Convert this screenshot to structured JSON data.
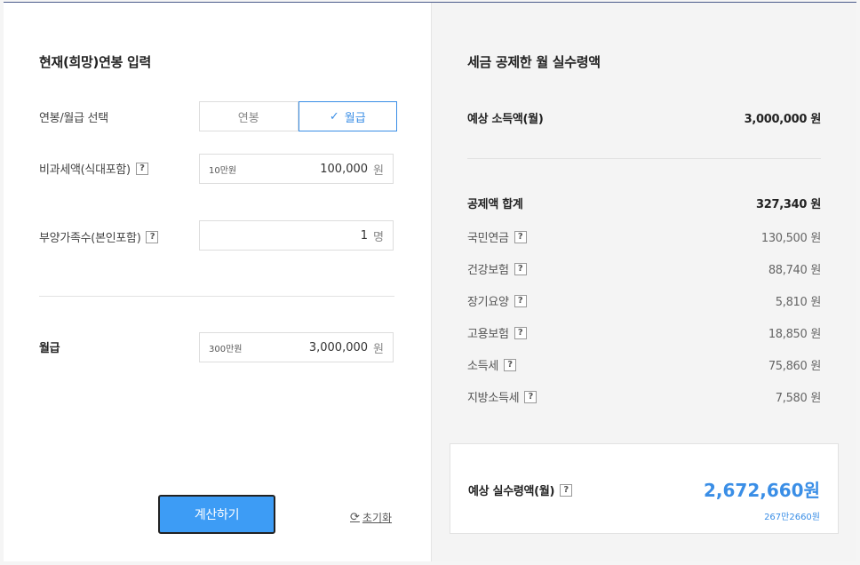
{
  "input_panel": {
    "title": "현재(희망)연봉 입력",
    "salary_type_label": "연봉/월급 선택",
    "salary_type_options": [
      "연봉",
      "월급"
    ],
    "salary_type_selected": "월급",
    "nontax_label": "비과세액(식대포함)",
    "nontax_hint": "10만원",
    "nontax_value": "100,000",
    "nontax_unit": "원",
    "dependents_label": "부양가족수(본인포함)",
    "dependents_value": "1",
    "dependents_unit": "명",
    "salary_label": "월급",
    "salary_hint": "300만원",
    "salary_value": "3,000,000",
    "salary_unit": "원",
    "calc_button": "계산하기",
    "reset_link": "초기화"
  },
  "result_panel": {
    "title": "세금 공제한 월 실수령액",
    "expected_income_label": "예상 소득액(월)",
    "expected_income_value": "3,000,000 원",
    "deduction_total_label": "공제액 합계",
    "deduction_total_value": "327,340 원",
    "deductions": [
      {
        "label": "국민연금",
        "value": "130,500 원"
      },
      {
        "label": "건강보험",
        "value": "88,740 원"
      },
      {
        "label": "장기요양",
        "value": "5,810 원"
      },
      {
        "label": "고용보험",
        "value": "18,850 원"
      },
      {
        "label": "소득세",
        "value": "75,860 원"
      },
      {
        "label": "지방소득세",
        "value": "7,580 원"
      }
    ],
    "net_label": "예상 실수령액(월)",
    "net_value": "2,672,660원",
    "net_korean": "267만2660원"
  },
  "icons": {
    "help": "?",
    "check": "✓",
    "reset": "⟳"
  },
  "colors": {
    "accent": "#3a8ee6",
    "button": "#3d9cf5",
    "panel_bg": "#f4f4f4"
  }
}
